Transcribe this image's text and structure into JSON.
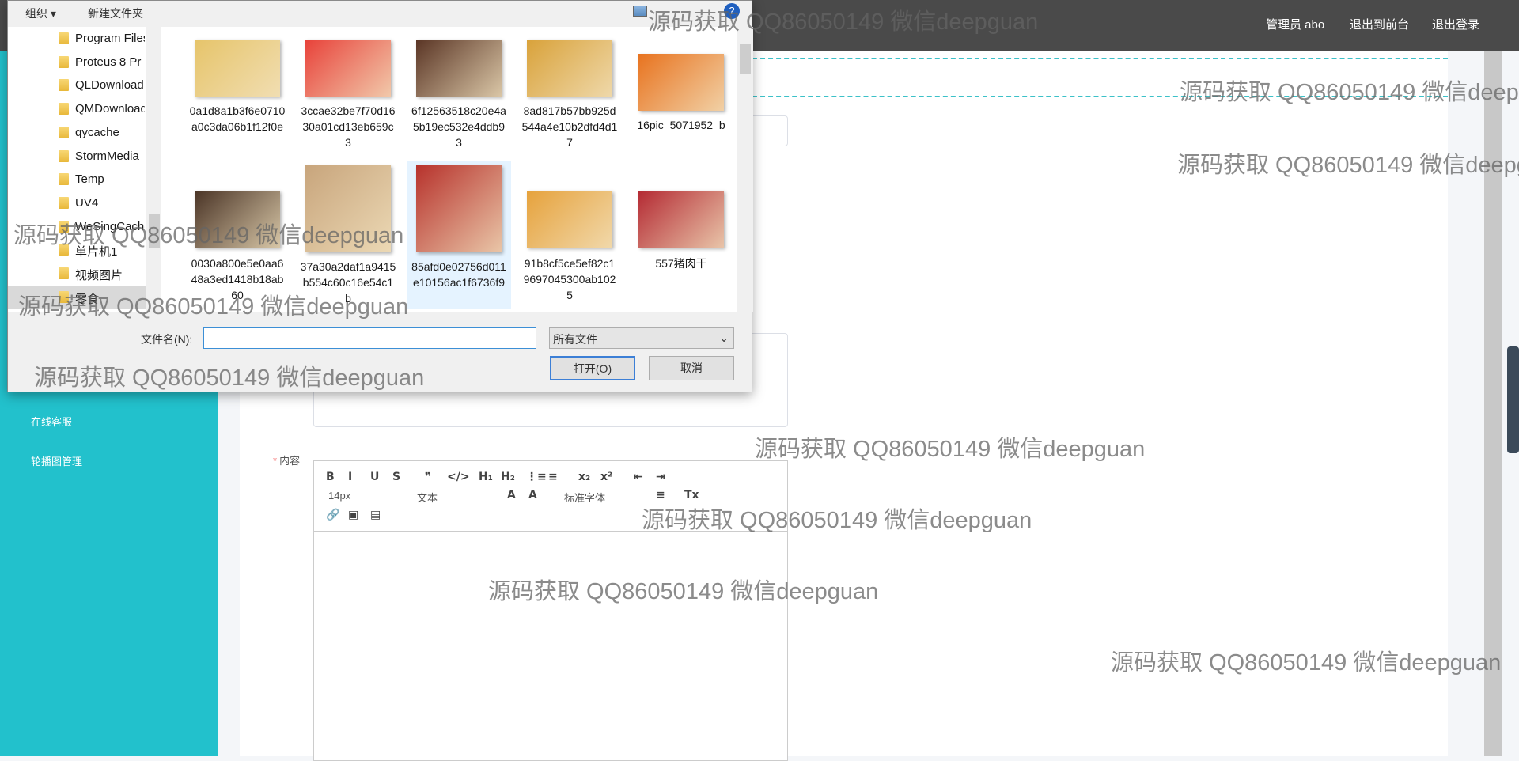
{
  "header": {
    "user": "管理员 abo",
    "to_front": "退出到前台",
    "logout": "退出登录"
  },
  "sidebar": {
    "items": [
      {
        "label": "在线客服"
      },
      {
        "label": "轮播图管理"
      }
    ]
  },
  "form": {
    "content_label": "内容",
    "required_mark": "*"
  },
  "editor": {
    "toolbar": {
      "bold": "B",
      "italic": "I",
      "underline": "U",
      "strike": "S",
      "quote": "❞",
      "code": "</>",
      "h1": "H₁",
      "h2": "H₂",
      "ol": "⋮≡",
      "ul": "≡",
      "sub": "x₂",
      "sup": "x²",
      "outdent": "⇤",
      "indent": "⇥",
      "size": "14px",
      "paragraph": "文本",
      "color": "A",
      "bg": "A",
      "font": "标准字体",
      "align": "≡",
      "clean": "Tx",
      "link": "🔗",
      "image": "▣",
      "video": "▤"
    }
  },
  "dialog": {
    "toolbar": {
      "organize": "组织 ▾",
      "new_folder": "新建文件夹"
    },
    "nav": [
      {
        "label": "Program Files"
      },
      {
        "label": "Proteus 8 Pr"
      },
      {
        "label": "QLDownload"
      },
      {
        "label": "QMDownload"
      },
      {
        "label": "qycache"
      },
      {
        "label": "StormMedia"
      },
      {
        "label": "Temp"
      },
      {
        "label": "UV4"
      },
      {
        "label": "WeSingCache"
      },
      {
        "label": "单片机1"
      },
      {
        "label": "视频图片"
      },
      {
        "label": "零食",
        "selected": true
      }
    ],
    "files": [
      {
        "name": "0a1d8a1b3f6e0710a0c3da06b1f12f0e",
        "color": "#e6c46a"
      },
      {
        "name": "3ccae32be7f70d1630a01cd13eb659c3",
        "color": "#e8423a"
      },
      {
        "name": "6f12563518c20e4a5b19ec532e4ddb93",
        "color": "#5a3525"
      },
      {
        "name": "8ad817b57bb925d544a4e10b2dfd4d17",
        "color": "#d9a23a"
      },
      {
        "name": "16pic_5071952_b",
        "color": "#e8731f"
      },
      {
        "name": "0030a800e5e0aa648a3ed1418b18ab60",
        "color": "#4a3426"
      },
      {
        "name": "37a30a2daf1a9415b554c60c16e54c1b",
        "color": "#c8a57c"
      },
      {
        "name": "85afd0e02756d011e10156ac1f6736f9",
        "color": "#b7322c",
        "selected": true
      },
      {
        "name": "91b8cf5ce5ef82c19697045300ab1025",
        "color": "#e6a23c"
      },
      {
        "name": "557猪肉干",
        "color": "#b42a33"
      }
    ],
    "filename_label": "文件名(N):",
    "filename_value": "",
    "filter": "所有文件",
    "open": "打开(O)",
    "cancel": "取消"
  },
  "watermark": "源码获取 QQ86050149 微信deepguan"
}
